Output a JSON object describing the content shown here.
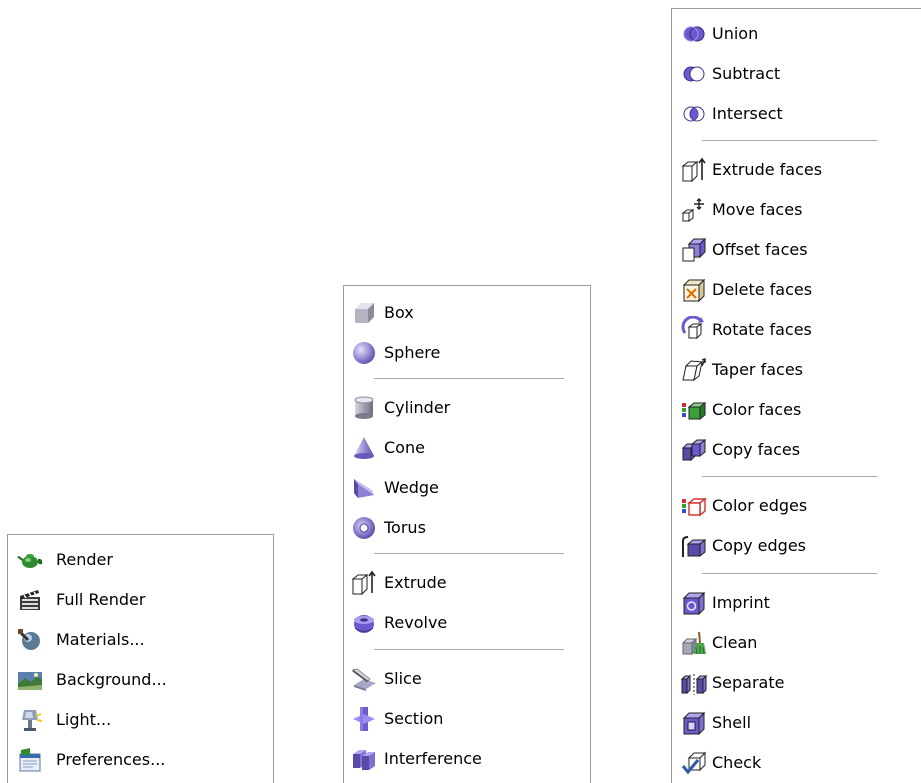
{
  "menus": {
    "render": {
      "items": [
        {
          "label": "Render",
          "icon": "teapot-icon"
        },
        {
          "label": "Full Render",
          "icon": "clapperboard-icon"
        },
        {
          "label": "Materials...",
          "icon": "materials-sphere-icon"
        },
        {
          "label": "Background...",
          "icon": "landscape-icon"
        },
        {
          "label": "Light...",
          "icon": "lamp-icon"
        },
        {
          "label": "Preferences...",
          "icon": "preferences-icon"
        }
      ]
    },
    "solids": {
      "items": [
        {
          "label": "Box",
          "icon": "box-icon"
        },
        {
          "label": "Sphere",
          "icon": "sphere-icon"
        },
        {
          "label": "Cylinder",
          "icon": "cylinder-icon"
        },
        {
          "label": "Cone",
          "icon": "cone-icon"
        },
        {
          "label": "Wedge",
          "icon": "wedge-icon"
        },
        {
          "label": "Torus",
          "icon": "torus-icon"
        },
        {
          "label": "Extrude",
          "icon": "extrude-icon"
        },
        {
          "label": "Revolve",
          "icon": "revolve-icon"
        },
        {
          "label": "Slice",
          "icon": "slice-icon"
        },
        {
          "label": "Section",
          "icon": "section-icon"
        },
        {
          "label": "Interference",
          "icon": "interference-icon"
        }
      ]
    },
    "edit": {
      "items": [
        {
          "label": "Union",
          "icon": "union-icon"
        },
        {
          "label": "Subtract",
          "icon": "subtract-icon"
        },
        {
          "label": "Intersect",
          "icon": "intersect-icon"
        },
        {
          "label": "Extrude faces",
          "icon": "extrude-faces-icon"
        },
        {
          "label": "Move faces",
          "icon": "move-faces-icon"
        },
        {
          "label": "Offset faces",
          "icon": "offset-faces-icon"
        },
        {
          "label": "Delete faces",
          "icon": "delete-faces-icon"
        },
        {
          "label": "Rotate faces",
          "icon": "rotate-faces-icon"
        },
        {
          "label": "Taper faces",
          "icon": "taper-faces-icon"
        },
        {
          "label": "Color faces",
          "icon": "color-faces-icon"
        },
        {
          "label": "Copy faces",
          "icon": "copy-faces-icon"
        },
        {
          "label": "Color edges",
          "icon": "color-edges-icon"
        },
        {
          "label": "Copy edges",
          "icon": "copy-edges-icon"
        },
        {
          "label": "Imprint",
          "icon": "imprint-icon"
        },
        {
          "label": "Clean",
          "icon": "clean-icon"
        },
        {
          "label": "Separate",
          "icon": "separate-icon"
        },
        {
          "label": "Shell",
          "icon": "shell-icon"
        },
        {
          "label": "Check",
          "icon": "check-icon"
        }
      ]
    }
  },
  "colors": {
    "menu_border": "#9a9a9a",
    "separator": "#a8a8a8",
    "icon_purple": "#6a5acd",
    "icon_gray": "#9a9aa8"
  }
}
